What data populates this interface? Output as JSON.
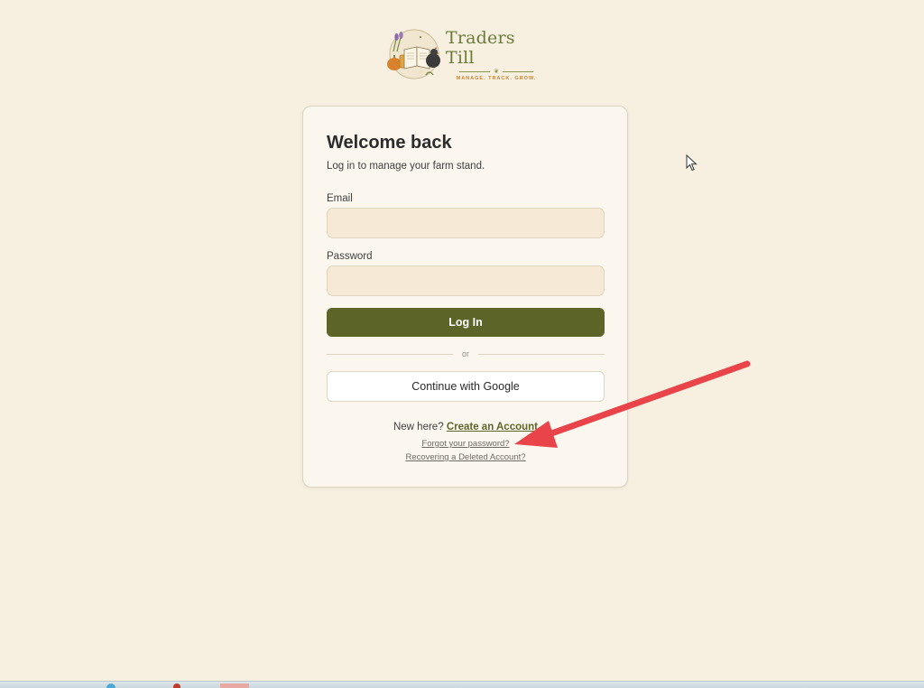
{
  "brand": {
    "name": "Traders Till",
    "tagline": "MANAGE. TRACK. GROW.",
    "emblem_icon": "farm-stand-emblem-icon",
    "colors": {
      "name": "#6b7a3a",
      "tagline": "#c7843a"
    }
  },
  "login": {
    "title": "Welcome back",
    "subtitle": "Log in to manage your farm stand.",
    "email_label": "Email",
    "email_value": "",
    "password_label": "Password",
    "password_value": "",
    "login_button": "Log In",
    "divider_text": "or",
    "google_button": "Continue with Google",
    "new_here_text": "New here?",
    "create_account_link": "Create an Account",
    "forgot_password_link": "Forgot your password?",
    "recover_account_link": "Recovering a Deleted Account?"
  },
  "theme": {
    "background": "#f7f0e1",
    "card_background": "#fbf7ef",
    "input_background": "#f6ead6",
    "primary_button": "#5d6428",
    "annotation_arrow": "#e8444a"
  }
}
